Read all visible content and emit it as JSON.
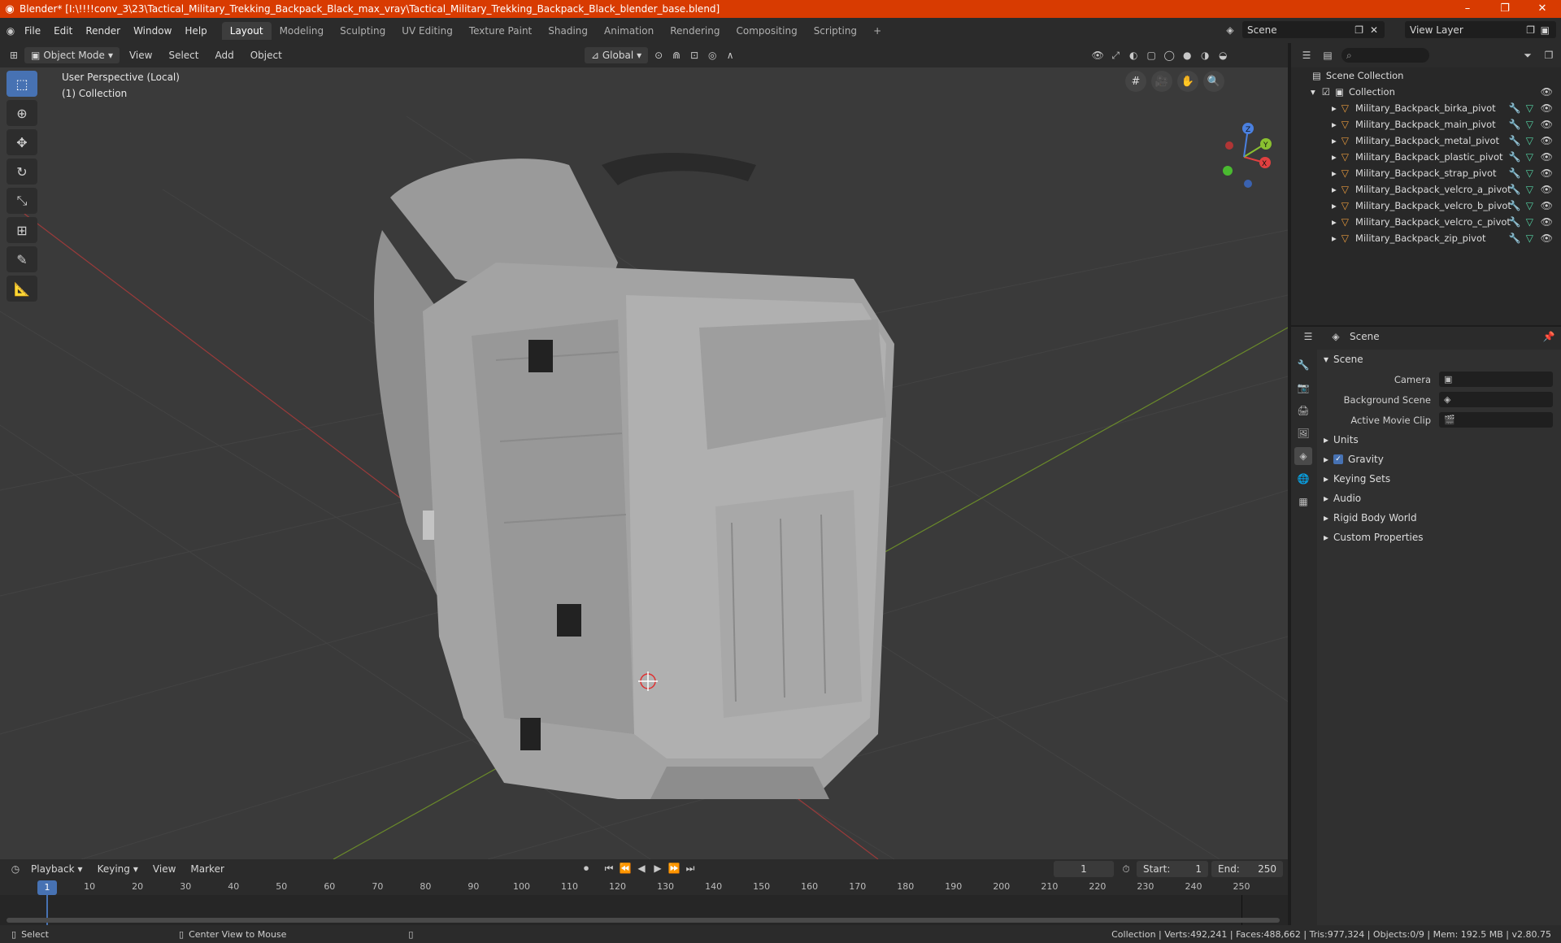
{
  "window": {
    "title": "Blender* [I:\\!!!!conv_3\\23\\Tactical_Military_Trekking_Backpack_Black_max_vray\\Tactical_Military_Trekking_Backpack_Black_blender_base.blend]"
  },
  "menu": {
    "file": "File",
    "edit": "Edit",
    "render": "Render",
    "window": "Window",
    "help": "Help"
  },
  "workspaces": [
    "Layout",
    "Modeling",
    "Sculpting",
    "UV Editing",
    "Texture Paint",
    "Shading",
    "Animation",
    "Rendering",
    "Compositing",
    "Scripting"
  ],
  "scene_selector": "Scene",
  "view_layer": "View Layer",
  "viewport": {
    "mode": "Object Mode",
    "view": "View",
    "select": "Select",
    "add": "Add",
    "object": "Object",
    "orientation": "Global",
    "info_line1": "User Perspective (Local)",
    "info_line2": "(1) Collection"
  },
  "outliner": {
    "root": "Scene Collection",
    "collection": "Collection",
    "objects": [
      "Military_Backpack_birka_pivot",
      "Military_Backpack_main_pivot",
      "Military_Backpack_metal_pivot",
      "Military_Backpack_plastic_pivot",
      "Military_Backpack_strap_pivot",
      "Military_Backpack_velcro_a_pivot",
      "Military_Backpack_velcro_b_pivot",
      "Military_Backpack_velcro_c_pivot",
      "Military_Backpack_zip_pivot"
    ]
  },
  "properties": {
    "header": "Scene",
    "panel": "Scene",
    "camera_label": "Camera",
    "background_scene_label": "Background Scene",
    "active_movie_clip_label": "Active Movie Clip",
    "subpanels": [
      "Units",
      "Gravity",
      "Keying Sets",
      "Audio",
      "Rigid Body World",
      "Custom Properties"
    ]
  },
  "timeline": {
    "playback": "Playback",
    "keying": "Keying",
    "view": "View",
    "marker": "Marker",
    "current_frame": "1",
    "start_label": "Start:",
    "start": "1",
    "end_label": "End:",
    "end": "250",
    "ticks": [
      "10",
      "20",
      "30",
      "40",
      "50",
      "60",
      "70",
      "80",
      "90",
      "100",
      "110",
      "120",
      "130",
      "140",
      "150",
      "160",
      "170",
      "180",
      "190",
      "200",
      "210",
      "220",
      "230",
      "240",
      "250"
    ]
  },
  "status": {
    "select": "Select",
    "center": "Center View to Mouse",
    "stats": "Collection | Verts:492,241 | Faces:488,662 | Tris:977,324 | Objects:0/9 | Mem: 192.5 MB | v2.80.75"
  }
}
